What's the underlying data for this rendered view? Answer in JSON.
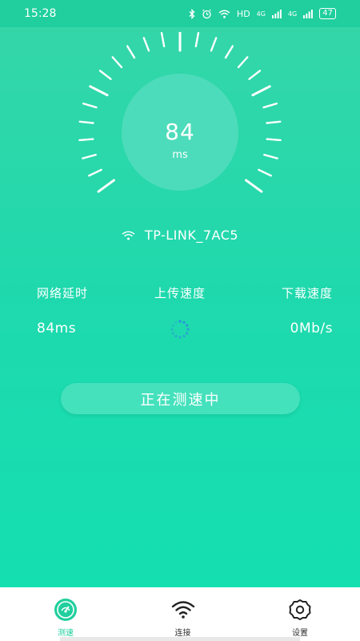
{
  "status_bar": {
    "time": "15:28",
    "hd_label": "HD",
    "signal_1_label": "4G",
    "signal_2_label": "4G",
    "battery": "47",
    "icons": [
      "bluetooth-icon",
      "alarm-icon",
      "wifi-icon",
      "signal-icon",
      "signal-icon"
    ]
  },
  "gauge": {
    "value": "84",
    "unit": "ms",
    "circle_color": "#4ddcbb"
  },
  "network": {
    "name": "TP-LINK_7AC5",
    "icon": "wifi-icon"
  },
  "stats": {
    "latency": {
      "label": "网络延时",
      "value": "84ms"
    },
    "upload": {
      "label": "上传速度",
      "value": ""
    },
    "download": {
      "label": "下载速度",
      "value": "0Mb/s"
    }
  },
  "action_button": {
    "label": "正在测速中"
  },
  "tabs": [
    {
      "label": "测速",
      "icon": "speedometer-icon",
      "active": true
    },
    {
      "label": "连接",
      "icon": "wifi-icon",
      "active": false
    },
    {
      "label": "设置",
      "icon": "gear-icon",
      "active": false
    }
  ],
  "colors": {
    "accent": "#20cf9d",
    "spinner": "#2f8fe0"
  }
}
